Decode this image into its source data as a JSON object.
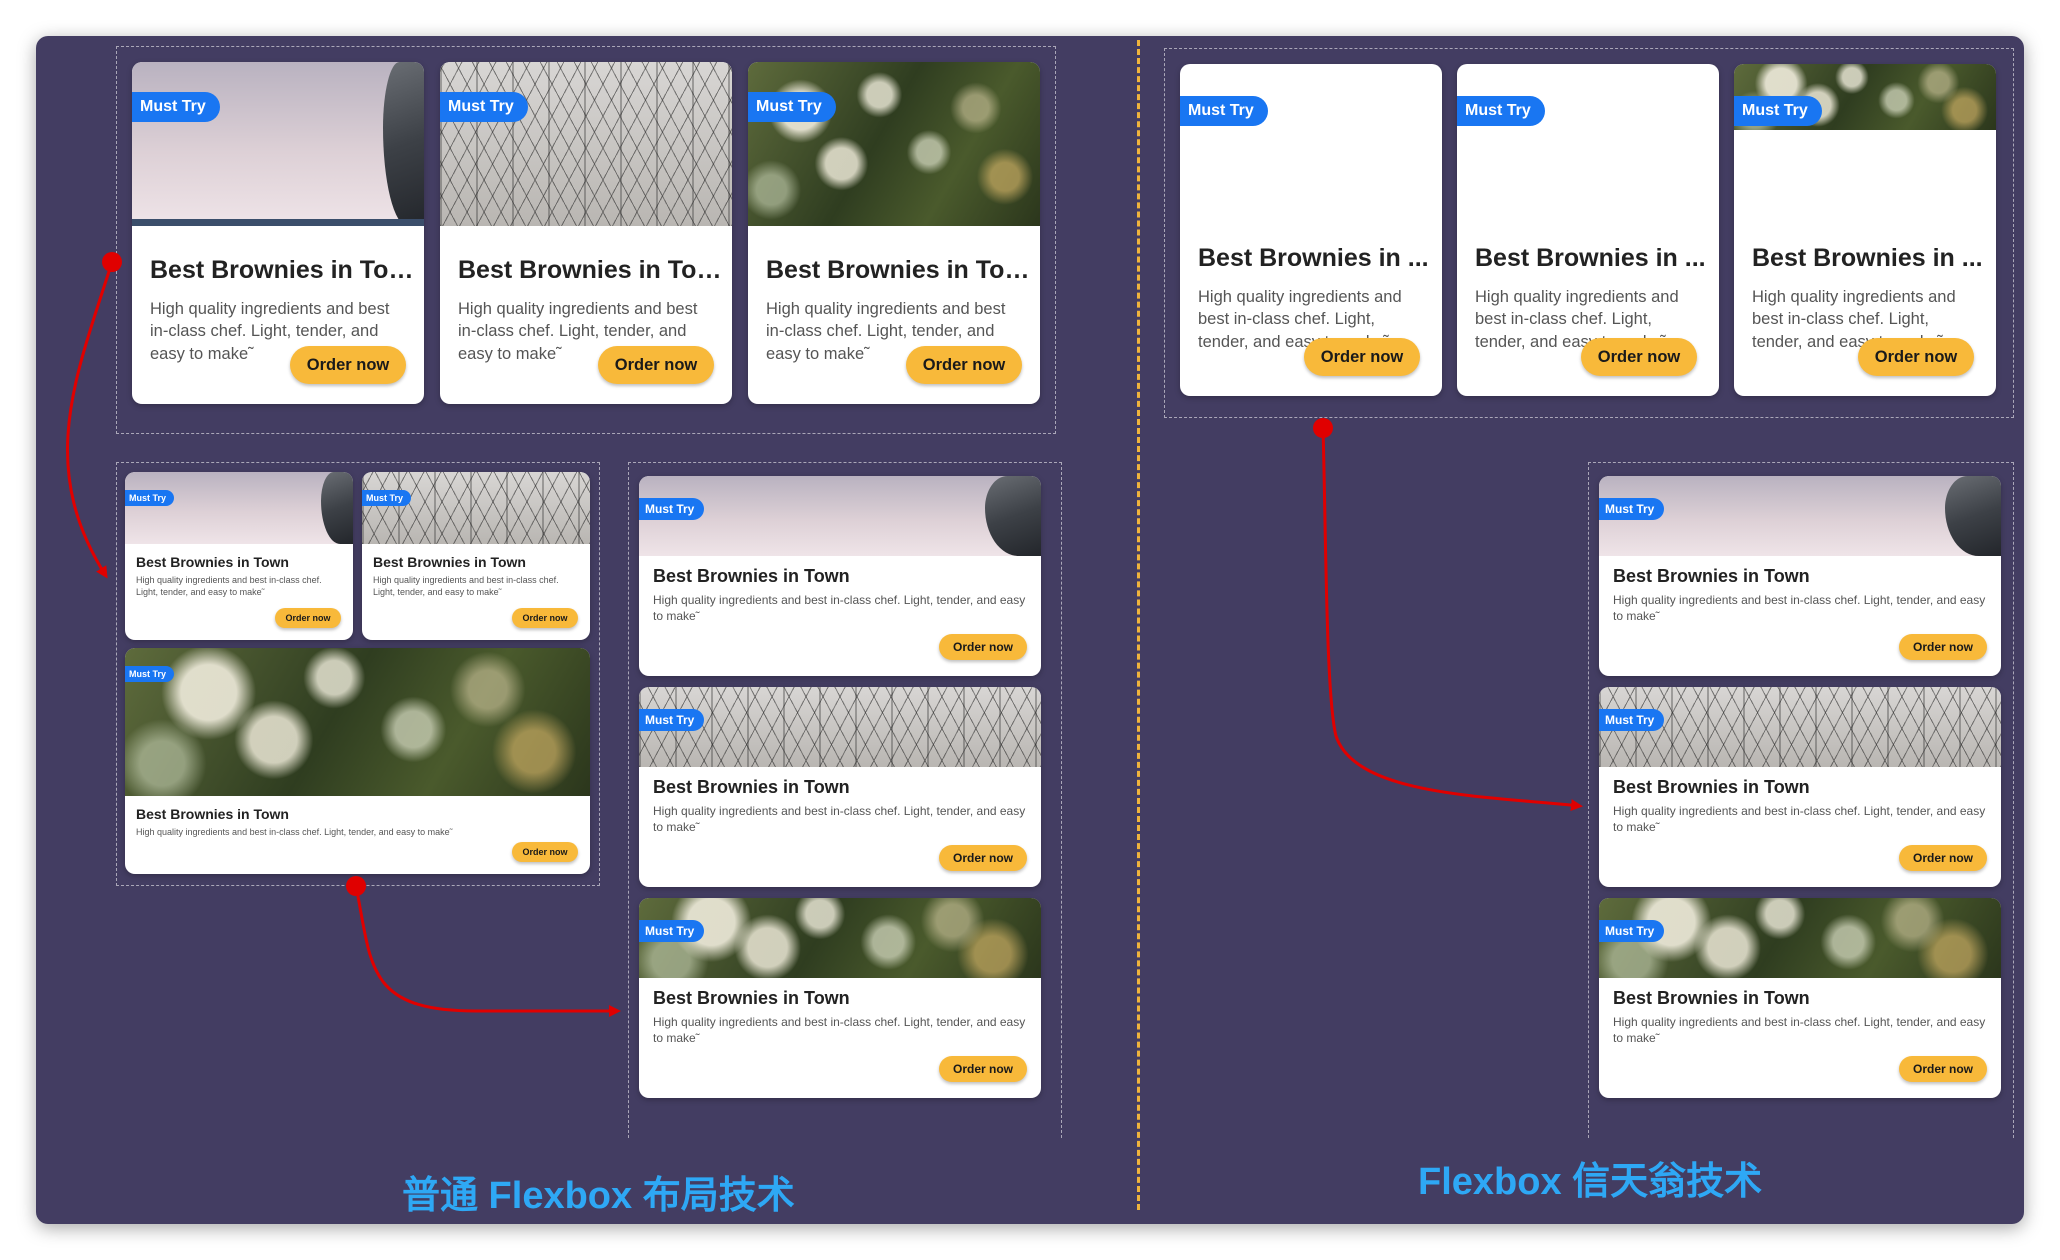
{
  "card": {
    "badge": "Must Try",
    "title": "Best Brownies in Town",
    "title_truncated": "Best Brownies in ...",
    "description": "High quality ingredients and best in-class chef. Light, tender, and easy to make˜",
    "button_label": "Order now",
    "images": [
      "sky-landscape",
      "bridge-cables",
      "green-bokeh"
    ]
  },
  "captions": {
    "left": "普通 Flexbox 布局技术",
    "right": "Flexbox 信天翁技术"
  },
  "colors": {
    "background": "#433d62",
    "badge": "#1976f2",
    "button": "#f8b93a",
    "arrow": "#e00000",
    "divider": "#f0b43c",
    "caption": "#2ea8f5"
  }
}
